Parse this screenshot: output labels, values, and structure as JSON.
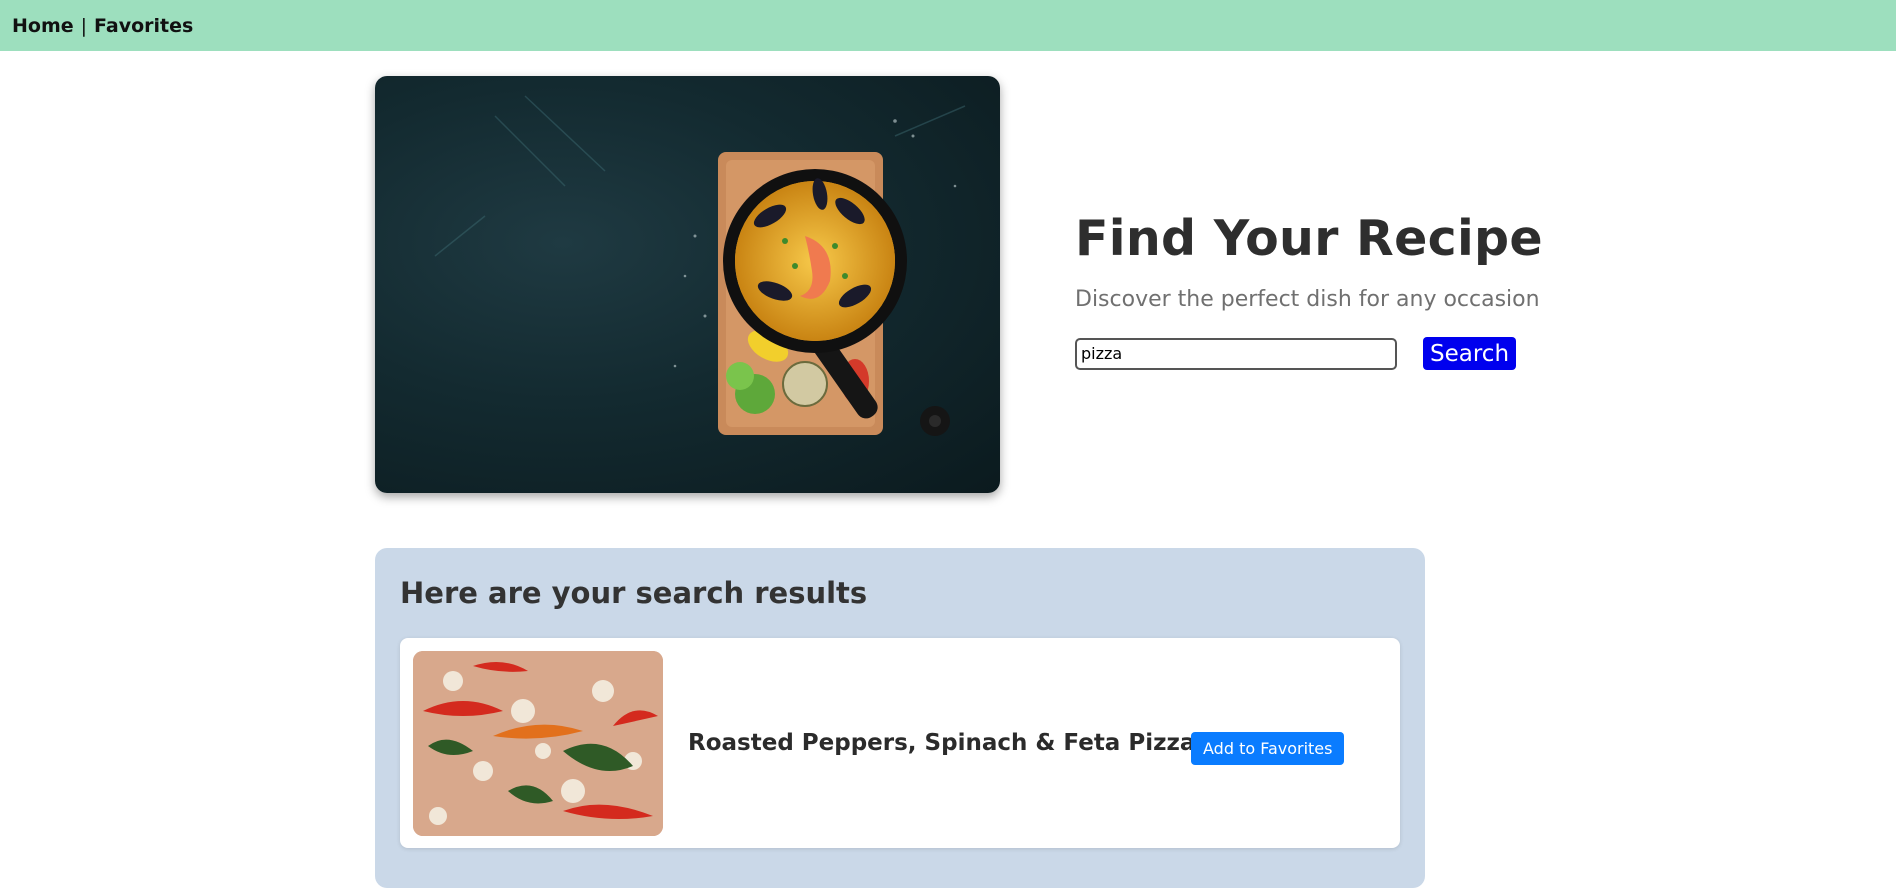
{
  "nav": {
    "home_label": "Home",
    "separator": "|",
    "favorites_label": "Favorites"
  },
  "hero": {
    "image_label": "Paella in a skillet on a wooden board",
    "title": "Find Your Recipe",
    "subtitle": "Discover the perfect dish for any occasion",
    "search_value": "pizza",
    "search_button_label": "Search"
  },
  "results": {
    "heading": "Here are your search results",
    "items": [
      {
        "title": "Roasted Peppers, Spinach & Feta Pizza",
        "favorite_button_label": "Add to Favorites"
      }
    ]
  },
  "colors": {
    "nav_bg": "#9ddfbe",
    "search_button": "#0000ee",
    "favorite_button": "#0a7cff",
    "results_bg": "#cad8e8"
  }
}
